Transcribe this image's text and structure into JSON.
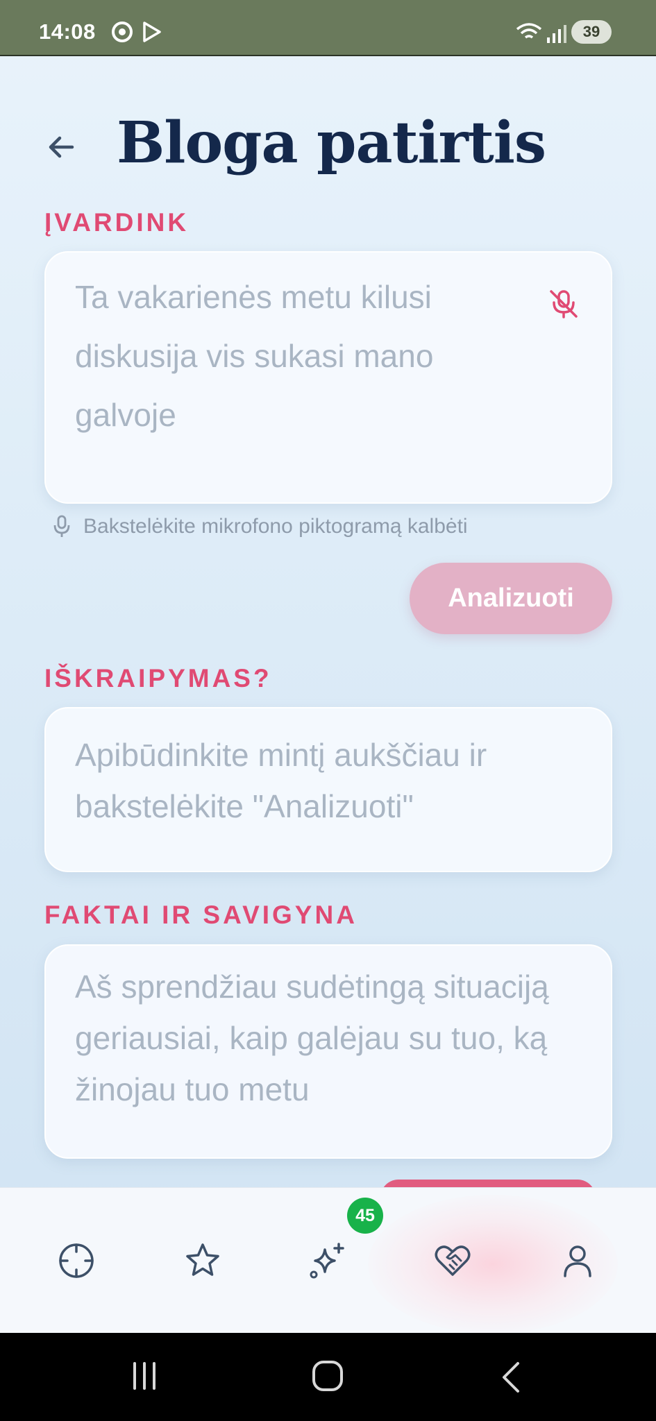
{
  "status_bar": {
    "time": "14:08",
    "battery": "39",
    "icons": [
      "chrome-icon",
      "play-store-icon",
      "wifi-icon",
      "signal-icon"
    ]
  },
  "header": {
    "title": "Bloga patirtis",
    "back_icon": "arrow-left-icon"
  },
  "sections": {
    "identify": {
      "label": "ĮVARDINK",
      "placeholder": "Ta vakarienės metu kilusi diskusija vis sukasi mano galvoje",
      "mic_icon": "mic-off-icon",
      "hint": "Bakstelėkite mikrofono piktogramą kalbėti",
      "analyze_button": "Analizuoti"
    },
    "distortion": {
      "label": "IŠKRAIPYMAS?",
      "text": "Apibūdinkite mintį aukščiau ir bakstelėkite \"Analizuoti\""
    },
    "facts": {
      "label": "FAKTAI IR SAVIGYNA",
      "placeholder": "Aš sprendžiau sudėtingą situaciją geriausiai, kaip galėjau su tuo, ką žinojau tuo metu"
    }
  },
  "bottom_nav": {
    "items": [
      "target-icon",
      "star-icon",
      "sparkles-icon",
      "heart-handshake-icon",
      "user-icon"
    ],
    "badge": "45",
    "colors": {
      "accent": "#e04a73",
      "badge": "#18b24a",
      "icon": "#3d5068"
    }
  },
  "system_nav": [
    "recents-icon",
    "home-icon",
    "back-icon"
  ]
}
